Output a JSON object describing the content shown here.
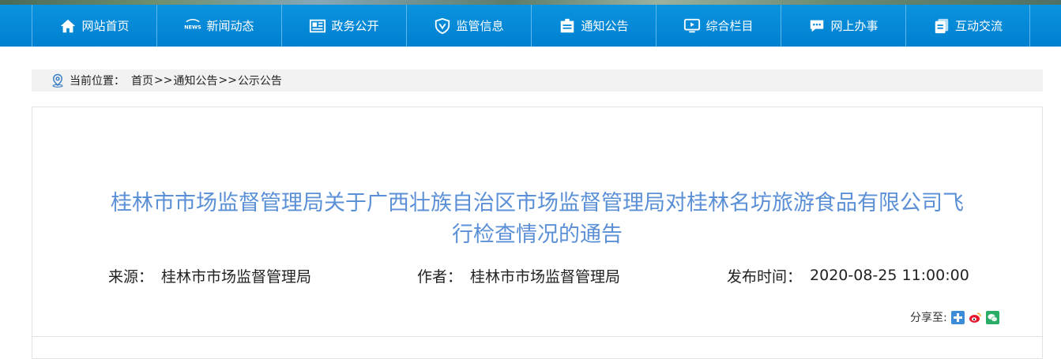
{
  "nav": {
    "items": [
      {
        "label": "网站首页",
        "icon": "home-icon"
      },
      {
        "label": "新闻动态",
        "icon": "news-icon"
      },
      {
        "label": "政务公开",
        "icon": "newspaper-icon"
      },
      {
        "label": "监管信息",
        "icon": "shield-icon"
      },
      {
        "label": "通知公告",
        "icon": "notice-icon"
      },
      {
        "label": "综合栏目",
        "icon": "monitor-icon"
      },
      {
        "label": "网上办事",
        "icon": "chat-icon"
      },
      {
        "label": "互动交流",
        "icon": "document-icon"
      }
    ]
  },
  "breadcrumb": {
    "prefix": "当前位置：",
    "items": [
      "首页",
      "通知公告",
      "公示公告"
    ],
    "separator": ">>"
  },
  "article": {
    "title_line1": "桂林市市场监督管理局关于广西壮族自治区市场监督管理局对桂林名坊旅游食品有限公司飞",
    "title_line2": "行检查情况的通告",
    "source_label": "来源：",
    "source": "桂林市市场监督管理局",
    "author_label": "作者：",
    "author": "桂林市市场监督管理局",
    "date_label": "发布时间：",
    "date": "2020-08-25 11:00:00"
  },
  "share": {
    "label": "分享至:",
    "icons": [
      "plus-share-icon",
      "weibo-icon",
      "wechat-icon"
    ]
  },
  "colors": {
    "nav_bg": "#0080d0",
    "title": "#5b8fd6",
    "breadcrumb_bg": "#f2f2f2"
  }
}
